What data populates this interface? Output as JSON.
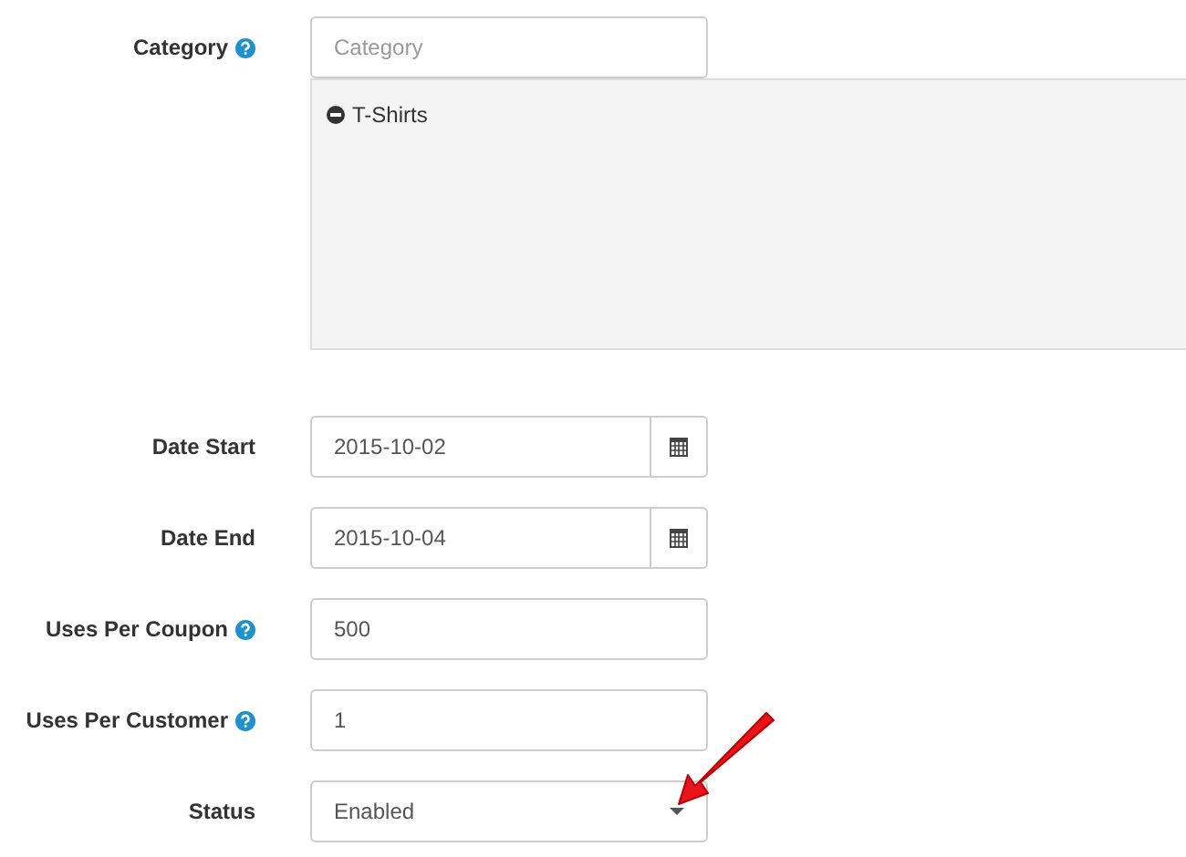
{
  "fields": [
    {
      "kind": "category",
      "label": "Category",
      "help": true,
      "placeholder": "Category",
      "selected_items": [
        {
          "label": "T-Shirts"
        }
      ]
    },
    {
      "kind": "date",
      "label": "Date Start",
      "help": false,
      "value": "2015-10-02"
    },
    {
      "kind": "date",
      "label": "Date End",
      "help": false,
      "value": "2015-10-04"
    },
    {
      "kind": "text",
      "label": "Uses Per Coupon",
      "help": true,
      "value": "500"
    },
    {
      "kind": "text",
      "label": "Uses Per Customer",
      "help": true,
      "value": "1"
    },
    {
      "kind": "select",
      "label": "Status",
      "help": false,
      "value": "Enabled"
    }
  ]
}
